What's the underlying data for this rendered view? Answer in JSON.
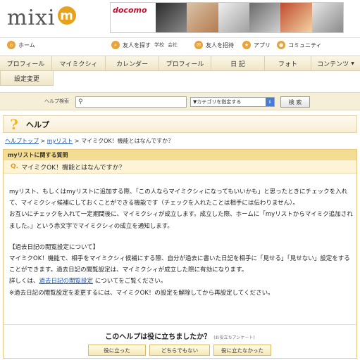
{
  "header": {
    "logo_text": "mixi",
    "logo_badge": "m",
    "banner_brand": "docomo"
  },
  "topnav": {
    "home": "ホーム",
    "find_friends": "友人を探す",
    "school": "学校",
    "company": "会社",
    "invite": "友人を招待",
    "apps": "アプリ",
    "community": "コミュニティ"
  },
  "tabs": [
    "プロフィール",
    "マイミクシィ",
    "カレンダー",
    "プロフィール",
    "日 記",
    "フォト",
    "コンテンツ"
  ],
  "settings_tab": "設定変更",
  "search": {
    "label": "ヘルプ検索",
    "value": "",
    "category": "▼カテゴリを指定する",
    "button": "検 索"
  },
  "help": {
    "icon_char": "?",
    "title": "ヘルプ"
  },
  "breadcrumb": {
    "link1": "ヘルプトップ",
    "sep1": " > ",
    "link2": "myリスト",
    "sep2": " > ",
    "current": "マイミクOK！機能とはなんですか？"
  },
  "qa": {
    "section": "myリストに関する質問",
    "q_prefix": "Q.",
    "question": "マイミクOK！機能とはなんですか？",
    "p1": "myリスト、もしくはmyリストに追加する際、「この人ならマイミクシィになってもいいかも」と思ったときにチェックを入れて、マイミクシィ候補にしておくことができる機能です（チェックを入れたことは相手には伝わりません）。",
    "p2": "お互いにチェックを入れて一定期間後に、マイミクシィが成立します。成立した際、ホームに「myリストからマイミク追加されました。」という赤文字でマイミクシィの成立を通知します。",
    "p3": "【過去日記の閲覧設定について】",
    "p4": "マイミクOK！機能で、相手をマイミクシィ候補にする際、自分が過去に書いた日記を相手に「見せる」「見せない」設定をすることができます。過去日記の閲覧設定は、マイミクシィが成立した際に有効になります。",
    "p5_pre": "詳しくは、",
    "p5_link": "過去日記の閲覧設定",
    "p5_post": " についてをご覧ください。",
    "p6": "※過去日記の閲覧設定を変更するには、マイミクOK！の設定を解除してから再設定してください。"
  },
  "feedback": {
    "question": "このヘルプは役に立ちましたか？",
    "note": "(お役立ちアンケート)",
    "btn_yes": "役に立った",
    "btn_neutral": "どちらでもない",
    "btn_no": "役に立たなかった"
  },
  "colors": {
    "accent": "#e8a33a",
    "link": "#1b56b8",
    "tab_bg": "#efe6c8",
    "qa_head": "#f5dc93"
  }
}
